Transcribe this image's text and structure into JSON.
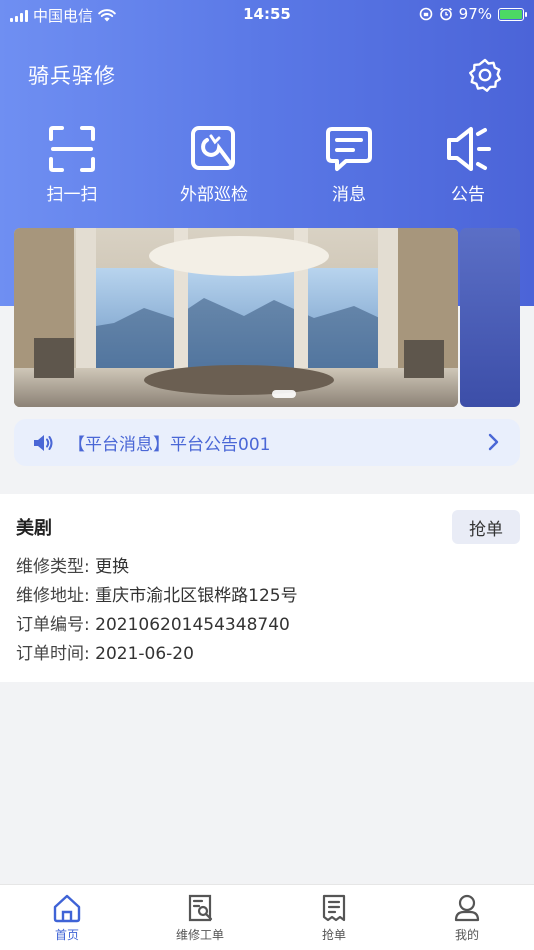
{
  "status_bar": {
    "carrier": "中国电信",
    "time": "14:55",
    "battery": "97%"
  },
  "app": {
    "title": "骑兵驿修"
  },
  "quick_actions": [
    {
      "label": "扫一扫",
      "icon": "scan-icon"
    },
    {
      "label": "外部巡检",
      "icon": "inspect-icon"
    },
    {
      "label": "消息",
      "icon": "message-icon"
    },
    {
      "label": "公告",
      "icon": "announcement-icon"
    }
  ],
  "notice": {
    "text": "【平台消息】平台公告001"
  },
  "order": {
    "title": "美剧",
    "grab_label": "抢单",
    "fields": [
      {
        "key": "维修类型:",
        "value": "更换"
      },
      {
        "key": "维修地址:",
        "value": "重庆市渝北区银桦路125号"
      },
      {
        "key": "订单编号:",
        "value": "20210620145434874​0"
      },
      {
        "key": "订单时间:",
        "value": "2021-06-20"
      }
    ]
  },
  "tabs": [
    {
      "label": "首页",
      "icon": "home-icon",
      "active": true
    },
    {
      "label": "维修工单",
      "icon": "work-order-icon",
      "active": false
    },
    {
      "label": "抢单",
      "icon": "grab-order-icon",
      "active": false
    },
    {
      "label": "我的",
      "icon": "profile-icon",
      "active": false
    }
  ],
  "colors": {
    "header_gradient_start": "#6f8ff2",
    "header_gradient_end": "#4b64d8",
    "accent": "#3f63d6",
    "notice_bg": "#e9effc"
  }
}
